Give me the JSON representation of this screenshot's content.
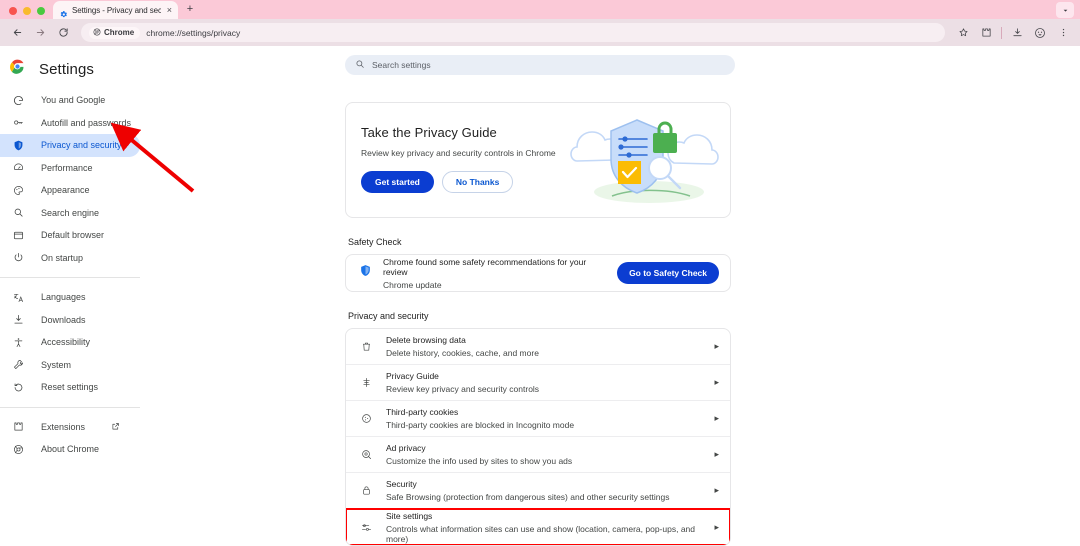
{
  "window": {
    "traffic_lights": [
      "close",
      "minimize",
      "maximize"
    ],
    "tab": {
      "favicon": "settings-gear-icon",
      "title": "Settings - Privacy and securit",
      "close_label": "×"
    },
    "new_tab_label": "+",
    "tabstrip_overflow_icon": "chevron-down-icon"
  },
  "toolbar": {
    "back_icon": "back-arrow-icon",
    "forward_icon": "forward-arrow-icon",
    "reload_icon": "reload-icon",
    "chrome_chip_label": "Chrome",
    "url": "chrome://settings/privacy",
    "bookmark_icon": "star-icon",
    "extensions_icon": "puzzle-icon",
    "downloads_icon": "download-icon",
    "profile_icon": "profile-avatar-icon",
    "menu_icon": "three-dot-menu-icon"
  },
  "sidebar": {
    "brand": "Settings",
    "brand_icon": "chrome-logo-icon",
    "items": [
      {
        "label": "You and Google",
        "icon": "google-g-icon",
        "selected": false
      },
      {
        "label": "Autofill and passwords",
        "icon": "key-icon",
        "selected": false
      },
      {
        "label": "Privacy and security",
        "icon": "shield-icon",
        "selected": true
      },
      {
        "label": "Performance",
        "icon": "speedometer-icon",
        "selected": false
      },
      {
        "label": "Appearance",
        "icon": "palette-icon",
        "selected": false
      },
      {
        "label": "Search engine",
        "icon": "magnifier-icon",
        "selected": false
      },
      {
        "label": "Default browser",
        "icon": "browser-window-icon",
        "selected": false
      },
      {
        "label": "On startup",
        "icon": "power-icon",
        "selected": false
      }
    ],
    "items2": [
      {
        "label": "Languages",
        "icon": "translate-icon"
      },
      {
        "label": "Downloads",
        "icon": "download-icon"
      },
      {
        "label": "Accessibility",
        "icon": "accessibility-icon"
      },
      {
        "label": "System",
        "icon": "wrench-icon"
      },
      {
        "label": "Reset settings",
        "icon": "reset-icon"
      }
    ],
    "items3": [
      {
        "label": "Extensions",
        "icon": "extensions-icon",
        "external": true
      },
      {
        "label": "About Chrome",
        "icon": "chrome-outline-icon",
        "external": false
      }
    ]
  },
  "search": {
    "placeholder": "Search settings",
    "icon": "search-icon"
  },
  "privacy_guide_card": {
    "title": "Take the Privacy Guide",
    "subtitle": "Review key privacy and security controls in Chrome",
    "primary_button": "Get started",
    "secondary_button": "No Thanks",
    "illustration": "shield-clouds-illustration"
  },
  "safety_check": {
    "section_label": "Safety Check",
    "icon": "shield-filled-icon",
    "title": "Chrome found some safety recommendations for your review",
    "subtitle": "Chrome update",
    "button": "Go to Safety Check"
  },
  "privacy_section": {
    "section_label": "Privacy and security",
    "rows": [
      {
        "title": "Delete browsing data",
        "subtitle": "Delete history, cookies, cache, and more",
        "icon": "trash-icon",
        "highlighted": false
      },
      {
        "title": "Privacy Guide",
        "subtitle": "Review key privacy and security controls",
        "icon": "privacy-guide-icon",
        "highlighted": false
      },
      {
        "title": "Third-party cookies",
        "subtitle": "Third-party cookies are blocked in Incognito mode",
        "icon": "cookie-icon",
        "highlighted": false
      },
      {
        "title": "Ad privacy",
        "subtitle": "Customize the info used by sites to show you ads",
        "icon": "ad-privacy-icon",
        "highlighted": false
      },
      {
        "title": "Security",
        "subtitle": "Safe Browsing (protection from dangerous sites) and other security settings",
        "icon": "lock-icon",
        "highlighted": false
      },
      {
        "title": "Site settings",
        "subtitle": "Controls what information sites can use and show (location, camera, pop-ups, and more)",
        "icon": "sliders-icon",
        "highlighted": true
      }
    ],
    "chevron": "▸"
  },
  "annotations": {
    "arrow_color": "#ee0000",
    "highlight_color": "#ff0000",
    "arrow_target": "Privacy and security"
  },
  "colors": {
    "accent_blue": "#0b57d0",
    "button_blue": "#0b3dd1",
    "selected_bg": "#d3e3fd",
    "tabstrip_bg": "#fbc9d7",
    "toolbar_bg": "#ecdfe5"
  }
}
